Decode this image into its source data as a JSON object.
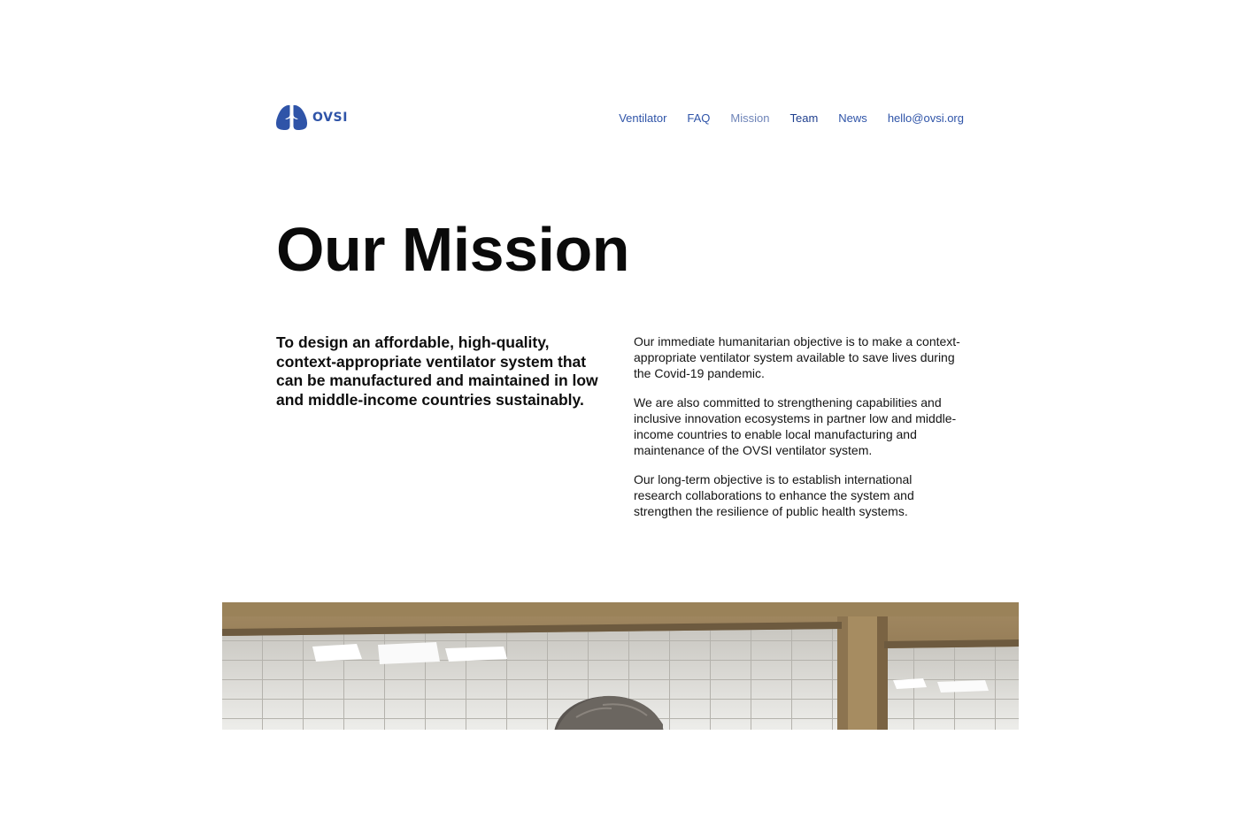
{
  "brand": {
    "name": "OVSI",
    "logo_icon": "lungs-icon",
    "color": "#2f54a8"
  },
  "nav": {
    "items": [
      {
        "label": "Ventilator"
      },
      {
        "label": "FAQ"
      },
      {
        "label": "Mission"
      },
      {
        "label": "Team"
      },
      {
        "label": "News"
      },
      {
        "label": "hello@ovsi.org"
      }
    ]
  },
  "main": {
    "title": "Our Mission",
    "lead": "To design an affordable, high-quality, context-appropriate ventilator system that can be manufactured and maintained in low and middle-income countries sustainably.",
    "paragraphs": [
      "Our immediate humanitarian objective is to make a context-appropriate ventilator system available to save lives during the Covid-19 pandemic.",
      "We are also committed to strengthening capabilities and inclusive innovation ecosystems in partner low and middle-income countries to enable local manufacturing and maintenance of the OVSI ventilator system.",
      "Our long-term objective is to establish international research collaborations to enhance the system and strengthen the resilience of public health systems."
    ]
  }
}
